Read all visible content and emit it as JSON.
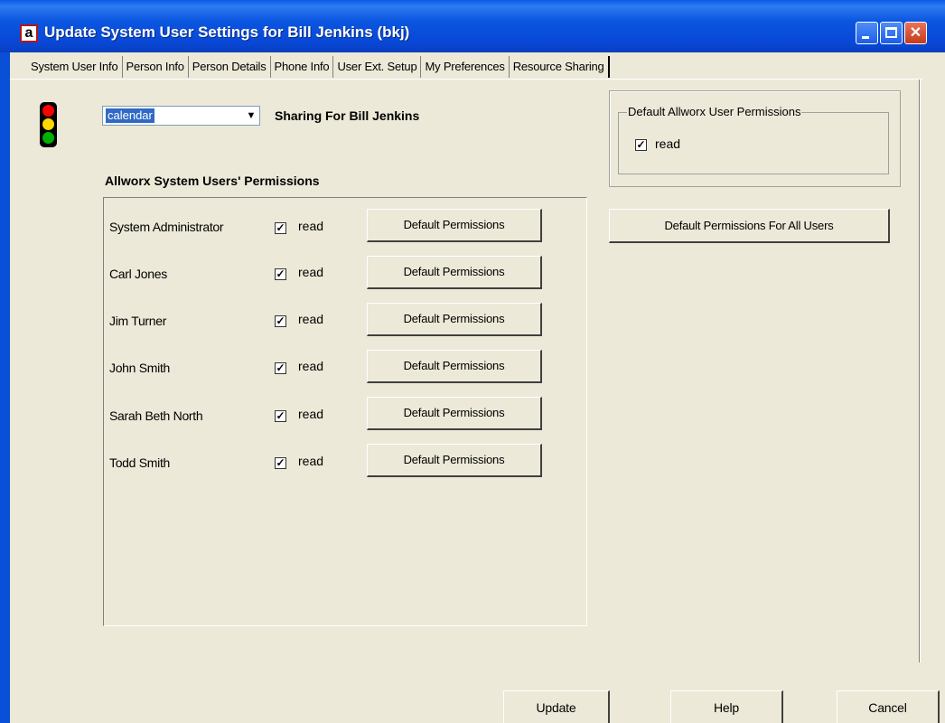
{
  "window": {
    "icon_glyph": "a",
    "title": "Update System User Settings for Bill Jenkins (bkj)",
    "controls": [
      "minimize",
      "maximize",
      "close"
    ]
  },
  "tabs": [
    {
      "label": "System User Info"
    },
    {
      "label": "Person Info"
    },
    {
      "label": "Person Details"
    },
    {
      "label": "Phone Info"
    },
    {
      "label": "User Ext. Setup"
    },
    {
      "label": "My Preferences"
    },
    {
      "label": "Resource Sharing",
      "active": true
    }
  ],
  "resource": {
    "selected": "calendar",
    "sharing_label": "Sharing For Bill Jenkins"
  },
  "traffic_light": {
    "colors": [
      "#ff0000",
      "#ffd800",
      "#00b000"
    ]
  },
  "default_permissions": {
    "title": "Default Allworx User Permissions",
    "read_label": "read",
    "read_checked": true,
    "apply_all_label": "Default Permissions For All Users"
  },
  "permissions": {
    "heading": "Allworx System Users' Permissions",
    "users": [
      {
        "name": "System Administrator",
        "read_label": "read",
        "read_checked": true,
        "button": "Default Permissions"
      },
      {
        "name": "Carl Jones",
        "read_label": "read",
        "read_checked": true,
        "button": "Default Permissions"
      },
      {
        "name": "Jim Turner",
        "read_label": "read",
        "read_checked": true,
        "button": "Default Permissions"
      },
      {
        "name": "John Smith",
        "read_label": "read",
        "read_checked": true,
        "button": "Default Permissions"
      },
      {
        "name": "Sarah Beth North",
        "read_label": "read",
        "read_checked": true,
        "button": "Default Permissions"
      },
      {
        "name": "Todd Smith",
        "read_label": "read",
        "read_checked": true,
        "button": "Default Permissions"
      }
    ]
  },
  "footer": {
    "update": "Update",
    "help": "Help",
    "cancel": "Cancel"
  }
}
